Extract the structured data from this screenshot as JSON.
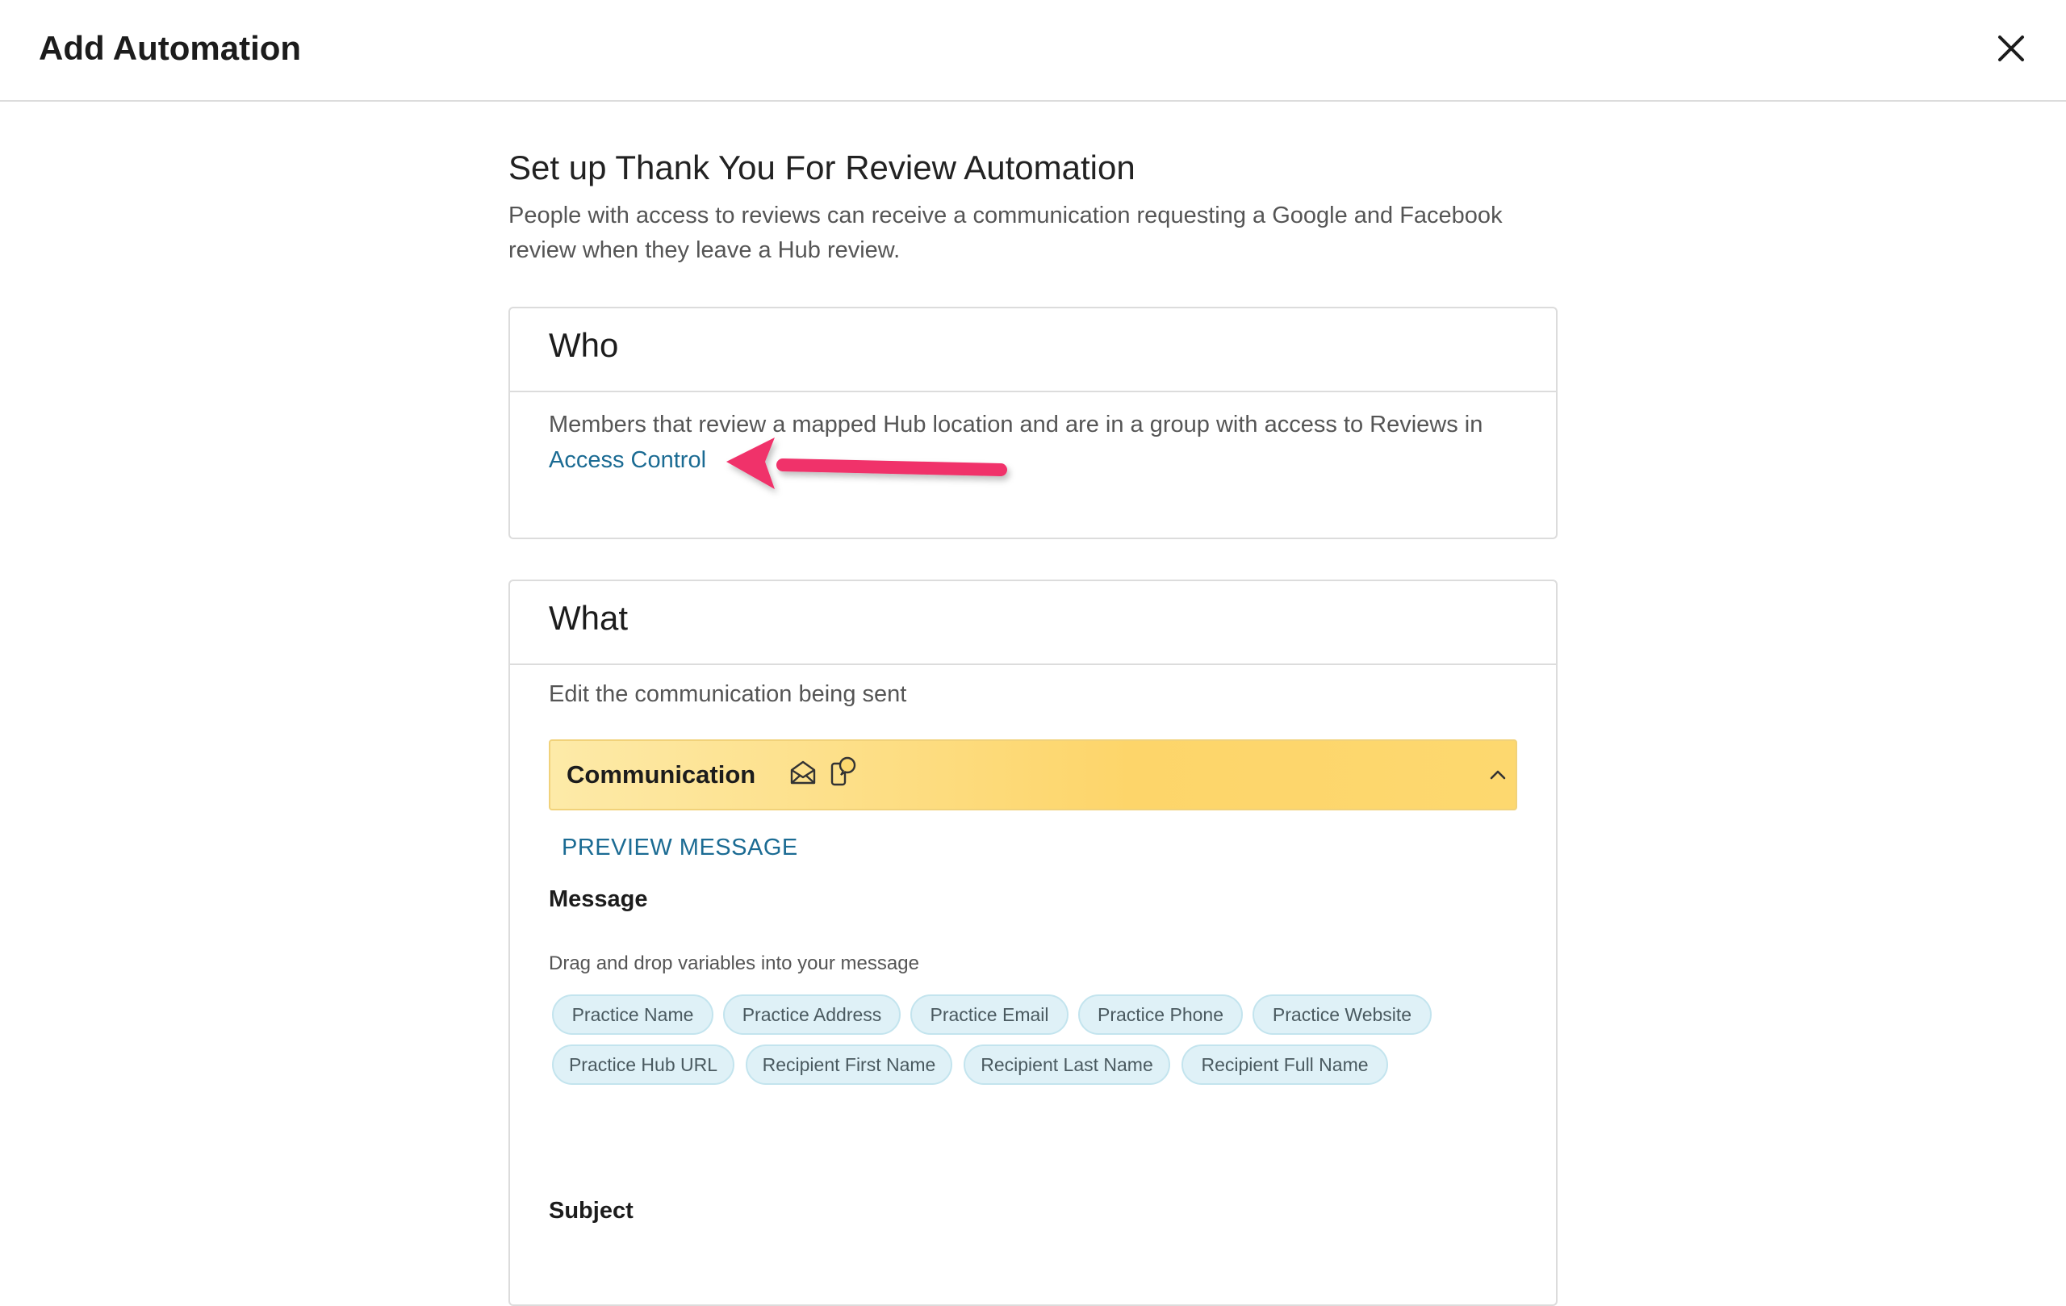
{
  "modal": {
    "title": "Add Automation",
    "close_icon": "close-icon"
  },
  "intro": {
    "heading": "Set up Thank You For Review Automation",
    "description": "People with access to reviews can receive a communication requesting a Google and Facebook review when they leave a Hub review."
  },
  "who": {
    "title": "Who",
    "text": "Members that review a mapped Hub location and are in a group with access to Reviews in",
    "link": "Access Control",
    "annotation_color": "#f0306a"
  },
  "what": {
    "title": "What",
    "subtitle": "Edit the communication being sent",
    "communication": {
      "title": "Communication",
      "icons": [
        "envelope-icon",
        "phone-chat-icon"
      ],
      "chevron": "chevron-up-icon"
    },
    "preview_label": "PREVIEW MESSAGE",
    "message_label": "Message",
    "drag_hint": "Drag and drop variables into your message",
    "variables": [
      "Practice Name",
      "Practice Address",
      "Practice Email",
      "Practice Phone",
      "Practice Website",
      "Practice Hub URL",
      "Recipient First Name",
      "Recipient Last Name",
      "Recipient Full Name"
    ],
    "subject_label": "Subject"
  },
  "colors": {
    "link": "#1b6b93",
    "chip_bg": "#dff1f7",
    "banner_yellow": "#fdd56a"
  }
}
